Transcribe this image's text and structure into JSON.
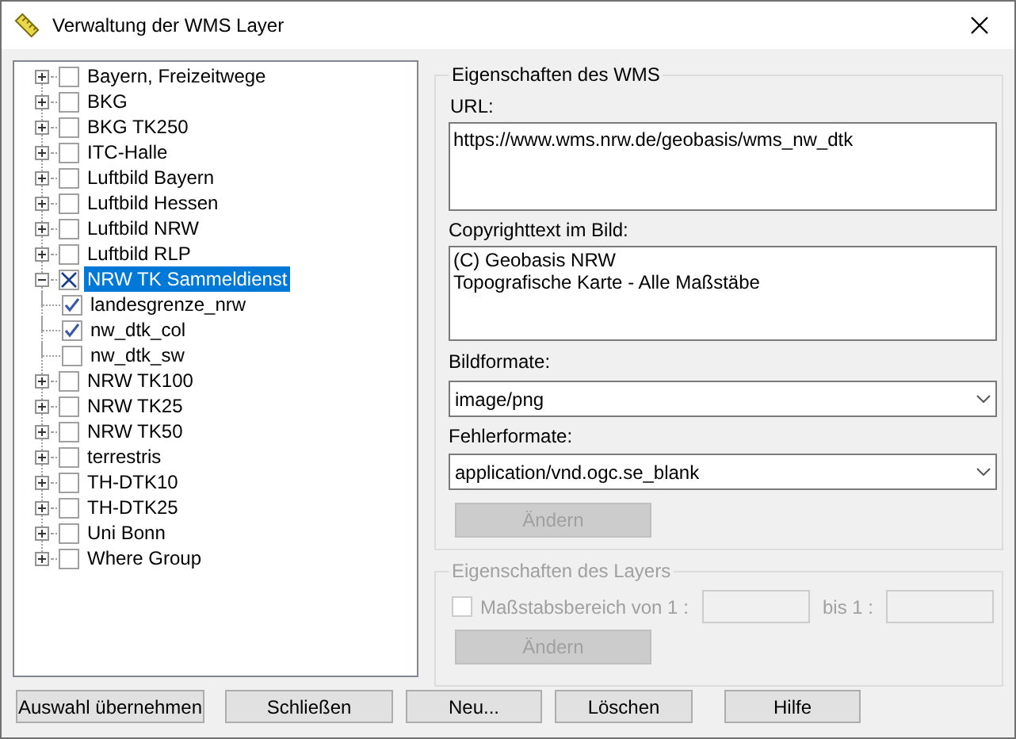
{
  "window": {
    "title": "Verwaltung der WMS Layer"
  },
  "tree": [
    {
      "label": "Bayern, Freizeitwege",
      "checked": false,
      "expanded": false,
      "selected": false
    },
    {
      "label": "BKG",
      "checked": false,
      "expanded": false,
      "selected": false
    },
    {
      "label": "BKG TK250",
      "checked": false,
      "expanded": false,
      "selected": false
    },
    {
      "label": "ITC-Halle",
      "checked": false,
      "expanded": false,
      "selected": false
    },
    {
      "label": "Luftbild Bayern",
      "checked": false,
      "expanded": false,
      "selected": false
    },
    {
      "label": "Luftbild Hessen",
      "checked": false,
      "expanded": false,
      "selected": false
    },
    {
      "label": "Luftbild NRW",
      "checked": false,
      "expanded": false,
      "selected": false
    },
    {
      "label": "Luftbild RLP",
      "checked": false,
      "expanded": false,
      "selected": false
    },
    {
      "label": "NRW TK Sammeldienst",
      "checked": true,
      "expanded": true,
      "selected": true,
      "children": [
        {
          "label": "landesgrenze_nrw",
          "checked": true,
          "selected": false
        },
        {
          "label": "nw_dtk_col",
          "checked": true,
          "selected": false
        },
        {
          "label": "nw_dtk_sw",
          "checked": false,
          "selected": false
        }
      ]
    },
    {
      "label": "NRW TK100",
      "checked": false,
      "expanded": false,
      "selected": false
    },
    {
      "label": "NRW TK25",
      "checked": false,
      "expanded": false,
      "selected": false
    },
    {
      "label": "NRW TK50",
      "checked": false,
      "expanded": false,
      "selected": false
    },
    {
      "label": "terrestris",
      "checked": false,
      "expanded": false,
      "selected": false
    },
    {
      "label": "TH-DTK10",
      "checked": false,
      "expanded": false,
      "selected": false
    },
    {
      "label": "TH-DTK25",
      "checked": false,
      "expanded": false,
      "selected": false
    },
    {
      "label": "Uni Bonn",
      "checked": false,
      "expanded": false,
      "selected": false
    },
    {
      "label": "Where Group",
      "checked": false,
      "expanded": false,
      "selected": false
    }
  ],
  "wms": {
    "title": "Eigenschaften des WMS",
    "url_label": "URL:",
    "url": "https://www.wms.nrw.de/geobasis/wms_nw_dtk",
    "copyright_label": "Copyrighttext im Bild:",
    "copyright": "(C) Geobasis NRW\nTopografische Karte - Alle Maßstäbe",
    "image_format_label": "Bildformate:",
    "image_format": "image/png",
    "error_format_label": "Fehlerformate:",
    "error_format": "application/vnd.ogc.se_blank",
    "apply_button": {
      "label": "Ändern",
      "disabled": true
    }
  },
  "layer": {
    "title": "Eigenschaften des Layers",
    "disabled": true,
    "scale_checkbox": {
      "label": "Maßstabsbereich von 1 :",
      "checked": false
    },
    "to_label": "bis 1 :",
    "apply_button": {
      "label": "Ändern",
      "disabled": true
    }
  },
  "buttons": [
    "Auswahl übernehmen",
    "Schließen",
    "Neu...",
    "Löschen",
    "Hilfe"
  ]
}
